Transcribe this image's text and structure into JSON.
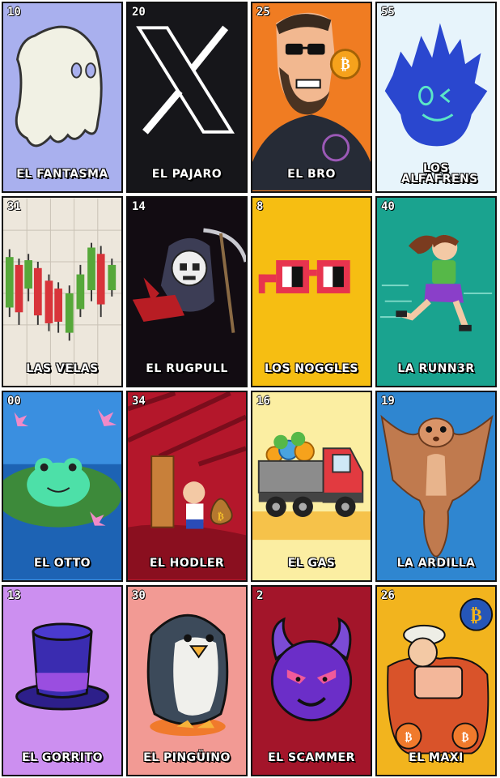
{
  "cards": [
    {
      "number": "10",
      "name": "EL FANTASMA",
      "bg": "#a9b0ee"
    },
    {
      "number": "20",
      "name": "EL PAJARO",
      "bg": "#16161a"
    },
    {
      "number": "25",
      "name": "EL BRO",
      "bg": "#f07c22"
    },
    {
      "number": "55",
      "name": "LOS ALFAFRENS",
      "bg": "#e7f4fb"
    },
    {
      "number": "31",
      "name": "LAS VELAS",
      "bg": "#ede7dc"
    },
    {
      "number": "14",
      "name": "EL RUGPULL",
      "bg": "#120c12"
    },
    {
      "number": "8",
      "name": "LOS NOGGLES",
      "bg": "#f6be12"
    },
    {
      "number": "40",
      "name": "LA RUNN3R",
      "bg": "#1aa38f"
    },
    {
      "number": "00",
      "name": "EL OTTO",
      "bg": "#3a8fe0"
    },
    {
      "number": "34",
      "name": "EL HODLER",
      "bg": "#b4172b"
    },
    {
      "number": "16",
      "name": "EL GAS",
      "bg": "#fbeea2"
    },
    {
      "number": "19",
      "name": "LA ARDILLA",
      "bg": "#2f86d0"
    },
    {
      "number": "13",
      "name": "EL GORRITO",
      "bg": "#cc8ff0"
    },
    {
      "number": "30",
      "name": "EL PINGÜINO",
      "bg": "#f29a94"
    },
    {
      "number": "2",
      "name": "EL SCAMMER",
      "bg": "#a3152a"
    },
    {
      "number": "26",
      "name": "EL MAXI",
      "bg": "#f2b41e"
    }
  ]
}
